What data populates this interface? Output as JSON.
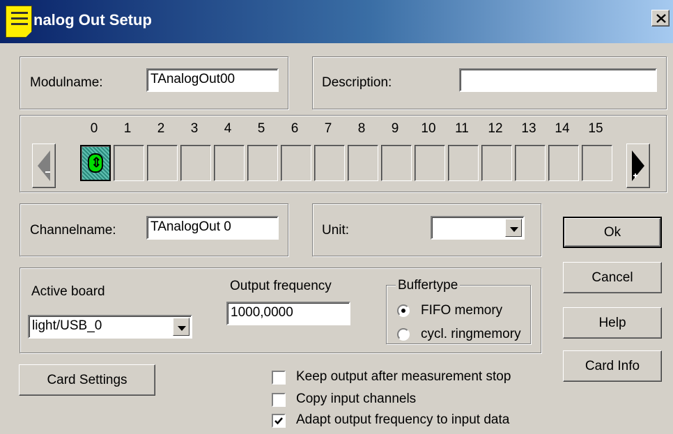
{
  "window": {
    "title": "nalog Out Setup",
    "close_label": "×"
  },
  "module": {
    "name_label": "Modulname:",
    "name_value": "TAnalogOut00",
    "desc_label": "Description:",
    "desc_value": ""
  },
  "channels": {
    "numbers": [
      "0",
      "1",
      "2",
      "3",
      "4",
      "5",
      "6",
      "7",
      "8",
      "9",
      "10",
      "11",
      "12",
      "13",
      "14",
      "15"
    ],
    "active_index": 0
  },
  "channel": {
    "name_label": "Channelname:",
    "name_value": "TAnalogOut 0",
    "unit_label": "Unit:",
    "unit_value": ""
  },
  "board": {
    "active_label": "Active board",
    "active_value": "light/USB_0",
    "freq_label": "Output frequency",
    "freq_value": "1000,0000",
    "buffertype_label": "Buffertype",
    "buffer_options": [
      {
        "label": "FIFO memory",
        "selected": true
      },
      {
        "label": "cycl. ringmemory",
        "selected": false
      }
    ]
  },
  "buttons": {
    "ok": "Ok",
    "cancel": "Cancel",
    "help": "Help",
    "card_info": "Card Info",
    "card_settings": "Card Settings"
  },
  "options": [
    {
      "label": "Keep output after measurement stop",
      "checked": false
    },
    {
      "label": "Copy input channels",
      "checked": false
    },
    {
      "label": "Adapt output frequency to input data",
      "checked": true
    }
  ],
  "colors": {
    "face": "#d4d0c8",
    "title_start": "#0a246a",
    "title_end": "#a6caf0",
    "active_channel": "#2a8a7c",
    "active_glyph": "#00dd00",
    "icon": "#ffee00"
  }
}
